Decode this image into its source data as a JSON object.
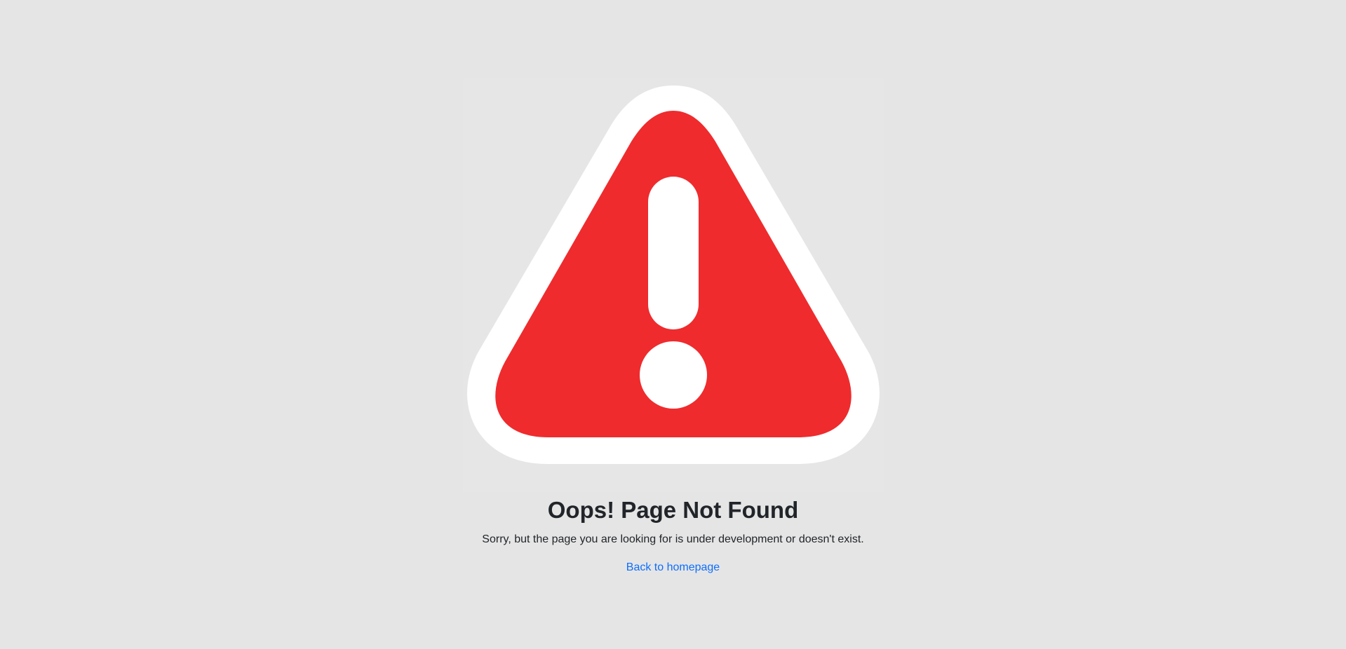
{
  "error": {
    "title": "Oops! Page Not Found",
    "message": "Sorry, but the page you are looking for is under development or doesn't exist.",
    "link_label": "Back to homepage"
  },
  "illustration": {
    "icon": "warning-triangle-icon",
    "fill_color": "#ef2b2d",
    "border_color": "#ffffff",
    "mark_color": "#ffffff"
  },
  "colors": {
    "background": "#e5e5e5",
    "text": "#212529",
    "link": "#0d6efd"
  }
}
